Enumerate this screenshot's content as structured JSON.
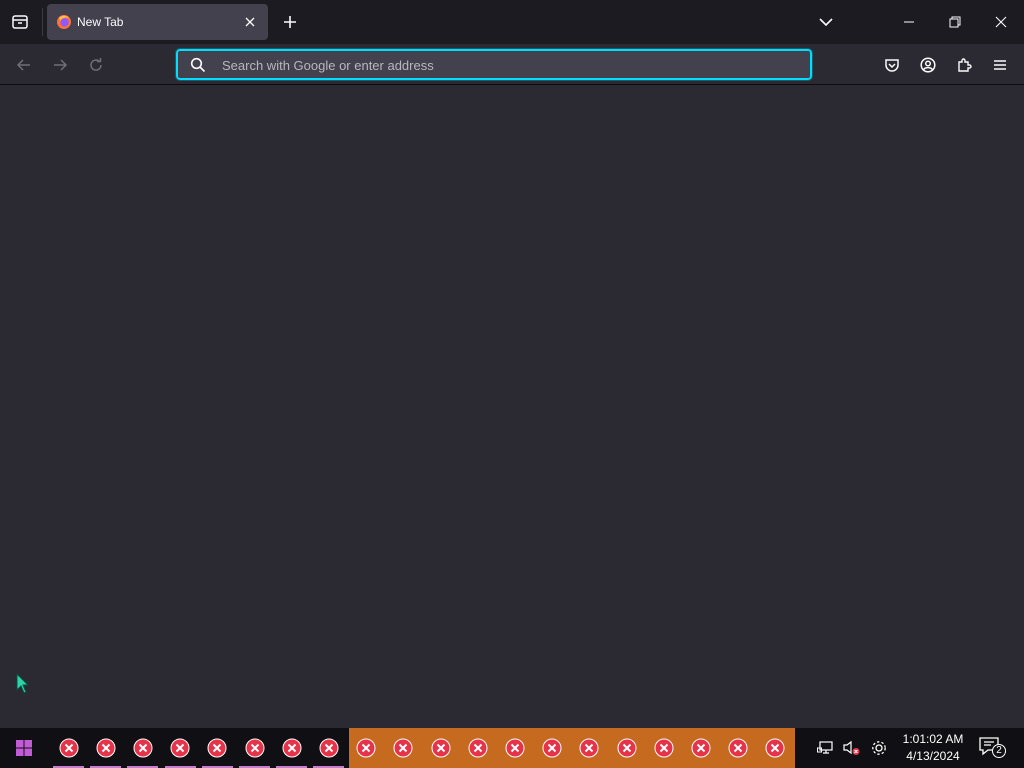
{
  "browser": {
    "tab": {
      "title": "New Tab"
    },
    "urlbar": {
      "placeholder": "Search with Google or enter address"
    },
    "colors": {
      "accent": "#00ddff",
      "tab_active": "#42414d",
      "tabbar_bg": "#1c1b22",
      "content_bg": "#2b2a33"
    }
  },
  "taskbar": {
    "items_icon": "error-x-icon",
    "items_count": 20,
    "clock": {
      "time": "1:01:02 AM",
      "date": "4/13/2024"
    },
    "notifications": {
      "count": "2"
    },
    "colors": {
      "highlight_block": "#c66a1f",
      "error_icon": "#e6334a"
    }
  }
}
